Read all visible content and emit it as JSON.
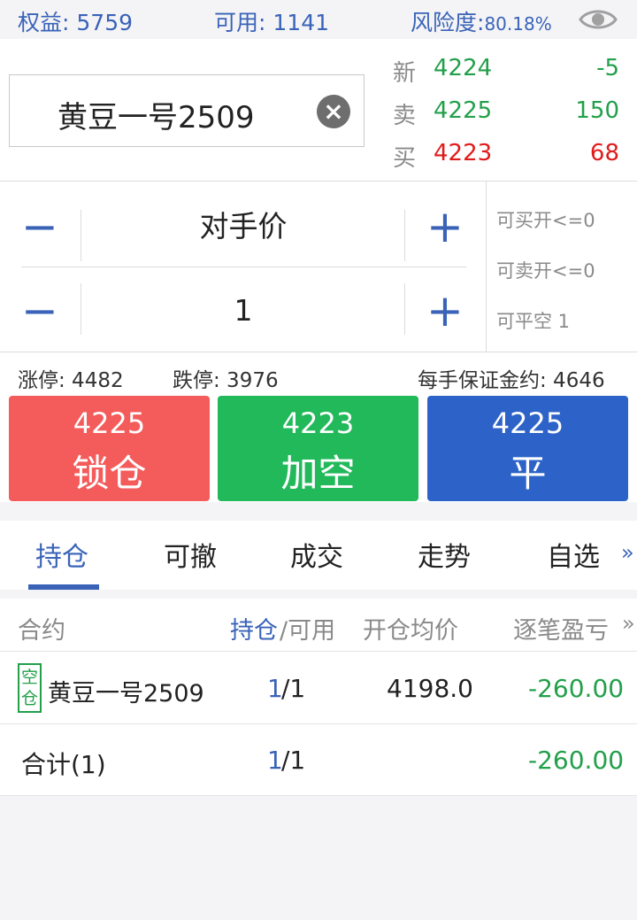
{
  "account": {
    "equity_label": "权益:",
    "equity_value": "5759",
    "available_label": "可用:",
    "available_value": "1141",
    "risk_label": "风险度:",
    "risk_value": "80.18%"
  },
  "icons": {
    "visibility": "eye-icon",
    "clear": "close-circle-icon",
    "more": "double-chevron-right-icon"
  },
  "symbol": {
    "name": "黄豆一号2509"
  },
  "quote": {
    "last": {
      "label": "新",
      "price": "4224",
      "change": "-5"
    },
    "ask": {
      "label": "卖",
      "price": "4225",
      "volume": "150"
    },
    "bid": {
      "label": "买",
      "price": "4223",
      "volume": "68"
    }
  },
  "order": {
    "minus": "−",
    "plus": "+",
    "price_type": "对手价",
    "quantity": "1"
  },
  "availability": {
    "can_buy_open": "可买开<=0",
    "can_sell_open": "可卖开<=0",
    "can_close_short": "可平空 1"
  },
  "limits": {
    "limit_up": "涨停: 4482",
    "limit_down": "跌停: 3976",
    "margin": "每手保证金约: 4646"
  },
  "actions": [
    {
      "price": "4225",
      "label": "锁仓",
      "color": "#f45b5b"
    },
    {
      "price": "4223",
      "label": "加空",
      "color": "#22b95a"
    },
    {
      "price": "4225",
      "label": "平",
      "color": "#2d63c8"
    }
  ],
  "tabs": [
    "持仓",
    "可撤",
    "成交",
    "走势",
    "自选"
  ],
  "tabs_more": "»",
  "table": {
    "headers": {
      "contract": "合约",
      "hold": "持仓",
      "slash_available": "/可用",
      "avg_price": "开仓均价",
      "pnl": "逐笔盈亏",
      "more": "»"
    },
    "rows": [
      {
        "tag_line1": "空",
        "tag_line2": "仓",
        "contract": "黄豆一号2509",
        "hold": "1",
        "available": "/1",
        "avg_price": "4198.0",
        "pnl": "-260.00"
      }
    ],
    "total": {
      "label": "合计(1)",
      "hold": "1",
      "available": "/1",
      "pnl": "-260.00"
    }
  },
  "colors": {
    "accent": "#3a63b8",
    "up": "#e11b1b",
    "down": "#22a04a"
  }
}
